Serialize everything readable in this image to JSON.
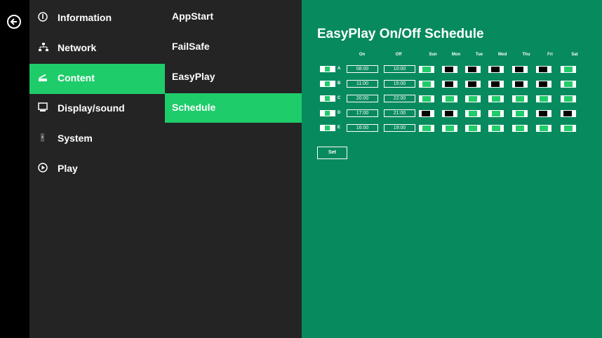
{
  "menu_level1": [
    {
      "label": "Information",
      "icon": "info-icon",
      "active": false
    },
    {
      "label": "Network",
      "icon": "network-icon",
      "active": false
    },
    {
      "label": "Content",
      "icon": "content-icon",
      "active": true
    },
    {
      "label": "Display/sound",
      "icon": "display-icon",
      "active": false
    },
    {
      "label": "System",
      "icon": "system-icon",
      "active": false
    },
    {
      "label": "Play",
      "icon": "play-icon",
      "active": false
    }
  ],
  "menu_level2": [
    {
      "label": "AppStart",
      "active": false
    },
    {
      "label": "FailSafe",
      "active": false
    },
    {
      "label": "EasyPlay",
      "active": false
    },
    {
      "label": "Schedule",
      "active": true
    }
  ],
  "schedule": {
    "title": "EasyPlay On/Off Schedule",
    "headers": {
      "on": "On",
      "off": "Off",
      "days": [
        "Sun",
        "Mon",
        "Tue",
        "Wed",
        "Thu",
        "Fri",
        "Sat"
      ]
    },
    "rows": [
      {
        "letter": "A",
        "on": "08:00",
        "off": "10:00",
        "days": [
          true,
          false,
          false,
          false,
          false,
          false,
          true
        ]
      },
      {
        "letter": "B",
        "on": "11:00",
        "off": "15:00",
        "days": [
          true,
          false,
          false,
          false,
          false,
          false,
          true
        ]
      },
      {
        "letter": "C",
        "on": "20:00",
        "off": "22:00",
        "days": [
          true,
          true,
          true,
          true,
          true,
          true,
          true
        ]
      },
      {
        "letter": "D",
        "on": "17:00",
        "off": "21:00",
        "days": [
          false,
          false,
          true,
          true,
          true,
          false,
          false
        ]
      },
      {
        "letter": "E",
        "on": "16:00",
        "off": "19:00",
        "days": [
          true,
          true,
          true,
          true,
          true,
          true,
          true
        ]
      }
    ],
    "set_label": "Set"
  },
  "colors": {
    "accent": "#1fcc6a",
    "panel_bg": "#078a5e",
    "menu_bg": "#242424"
  }
}
